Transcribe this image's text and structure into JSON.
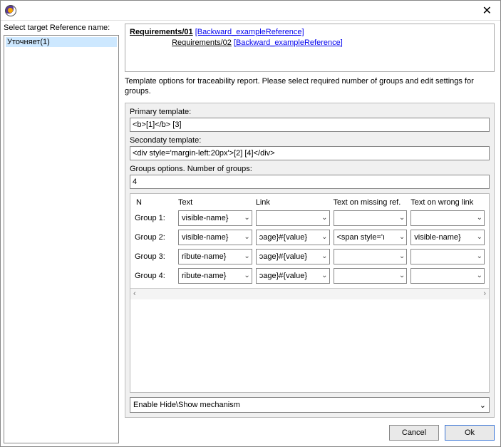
{
  "titlebar": {
    "close_glyph": "✕"
  },
  "left": {
    "label": "Select target Reference name:",
    "items": [
      "Уточняет(1)"
    ]
  },
  "preview": {
    "row1": {
      "req": "Requirements/01",
      "link": "[Backward_exampleReference]"
    },
    "row2": {
      "req": "Requirements/02",
      "link": "[Backward_exampleReference]"
    }
  },
  "description": "Template options for traceability report. Please select required number of groups and edit settings for groups.",
  "opts": {
    "primary_label": "Primary template:",
    "primary_value": "<b>[1]</b> [3]",
    "secondary_label": "Secondaty template:",
    "secondary_value": "<div style='margin-left:20px'>[2] [4]</div>",
    "groups_label": "Groups options. Number of groups:",
    "groups_value": "4",
    "headers": {
      "n": "N",
      "text": "Text",
      "link": "Link",
      "missing": "Text on missing ref.",
      "wrong": "Text on wrong link"
    },
    "rows": [
      {
        "label": "Group 1:",
        "text": "visible-name}",
        "link": "",
        "missing": "",
        "wrong": ""
      },
      {
        "label": "Group 2:",
        "text": "visible-name}",
        "link": "ɔage}#{value}",
        "missing": "<span style='ı",
        "wrong": "visible-name}"
      },
      {
        "label": "Group 3:",
        "text": "ribute-name}",
        "link": "ɔage}#{value}",
        "missing": "",
        "wrong": ""
      },
      {
        "label": "Group 4:",
        "text": "ribute-name}",
        "link": "ɔage}#{value}",
        "missing": "",
        "wrong": ""
      }
    ],
    "enable_label": "Enable Hide\\Show mechanism"
  },
  "buttons": {
    "cancel": "Cancel",
    "ok": "Ok"
  },
  "glyphs": {
    "chev_down": "⌄",
    "left": "‹",
    "right": "›"
  }
}
